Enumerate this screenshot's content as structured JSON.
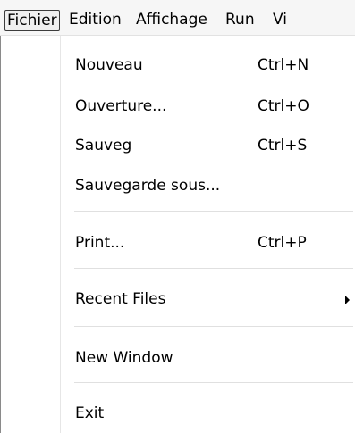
{
  "menubar": {
    "items": [
      {
        "label": "Fichier"
      },
      {
        "label": "Edition"
      },
      {
        "label": "Affichage"
      },
      {
        "label": "Run"
      },
      {
        "label": "Vi"
      }
    ]
  },
  "file_menu": {
    "items": [
      {
        "label": "Nouveau",
        "shortcut": "Ctrl+N"
      },
      {
        "label": "Ouverture...",
        "shortcut": "Ctrl+O"
      },
      {
        "label": "Sauveg",
        "shortcut": "Ctrl+S"
      },
      {
        "label": "Sauvegarde sous...",
        "shortcut": ""
      },
      {
        "label": "Print...",
        "shortcut": "Ctrl+P"
      },
      {
        "label": "Recent Files",
        "submenu_icon": "submenu-arrow-icon"
      },
      {
        "label": "New Window"
      },
      {
        "label": "Exit"
      }
    ]
  }
}
